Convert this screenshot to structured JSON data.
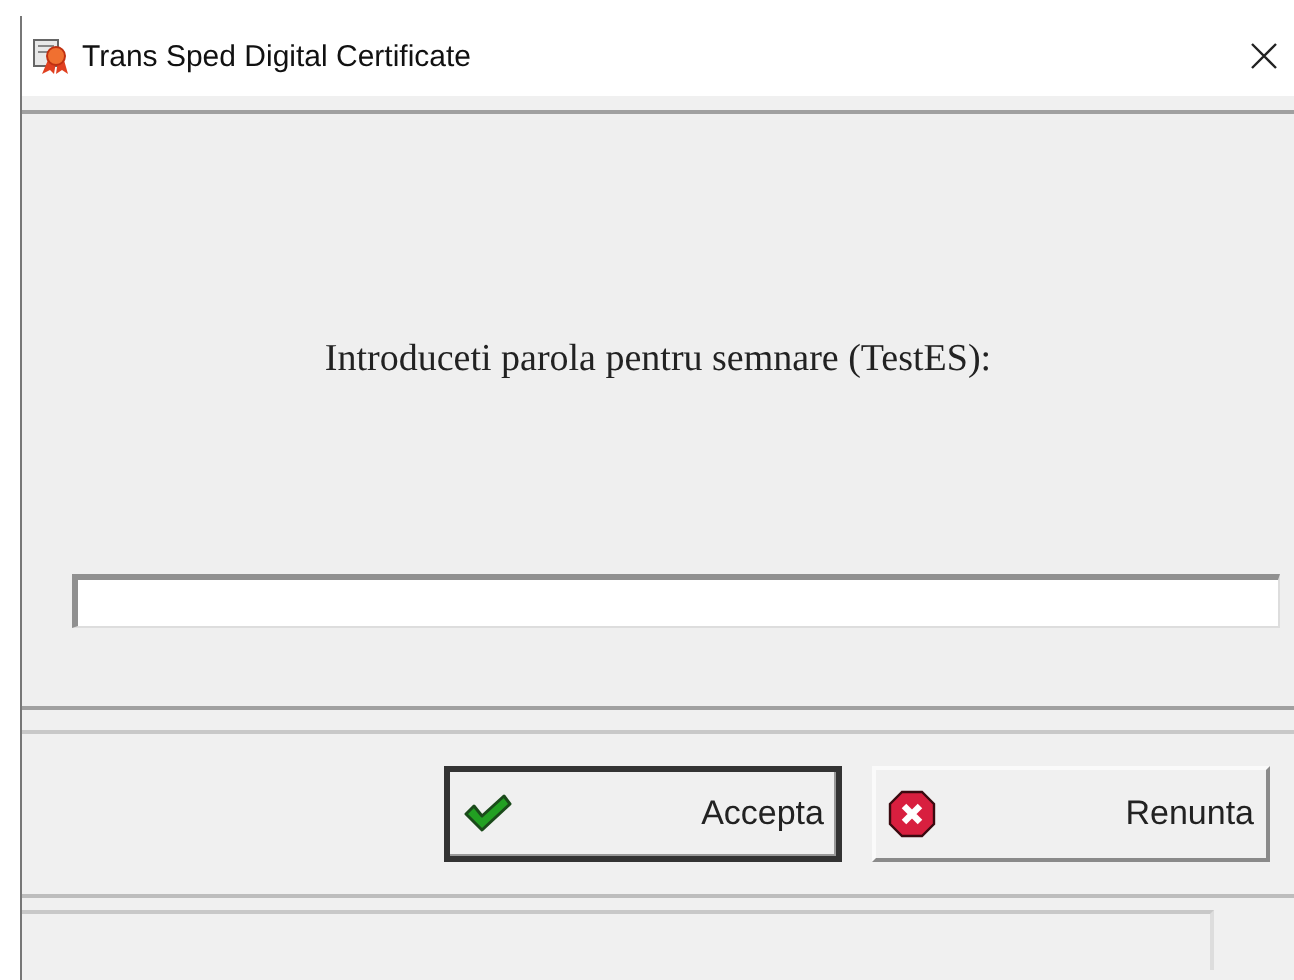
{
  "window": {
    "title": "Trans Sped Digital Certificate"
  },
  "prompt": "Introduceti parola pentru semnare (TestES):",
  "buttons": [
    {
      "label": "Accepta",
      "kind": "accept",
      "default": true
    },
    {
      "label": "Renunta",
      "kind": "cancel",
      "default": false
    }
  ]
}
